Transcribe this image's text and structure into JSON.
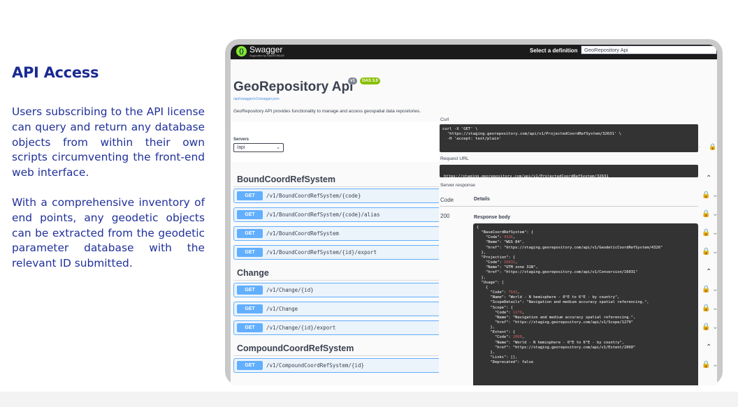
{
  "left": {
    "heading": "API Access",
    "para1": "Users subscribing to the API license can query and return any database objects from within their own scripts circumventing the front-end web interface.",
    "para2": "With a comprehensive inventory of end points, any geodetic objects can be extracted from the geodetic parameter database with the relevant ID submitted."
  },
  "topbar": {
    "logo_text": "Swagger",
    "logo_sub": "Supported by SMARTBEAR",
    "definition_label": "Select a definition",
    "definition_value": "GeoRepository Api"
  },
  "api": {
    "title": "GeoRepository Api",
    "version_badge": "v1",
    "oas_badge": "OAS 3.0",
    "spec_url": "/api/swagger/v1/swagger.json",
    "description": "GeoRepository API provides functionality to manage and access geospatial data repositories.",
    "servers_label": "Servers",
    "servers_value": "/api"
  },
  "sections": [
    {
      "tag": "BoundCoordRefSystem",
      "ops": [
        {
          "method": "GET",
          "path": "/v1/BoundCoordRefSystem/{code}"
        },
        {
          "method": "GET",
          "path": "/v1/BoundCoordRefSystem/{code}/alias"
        },
        {
          "method": "GET",
          "path": "/v1/BoundCoordRefSystem"
        },
        {
          "method": "GET",
          "path": "/v1/BoundCoordRefSystem/{id}/export"
        }
      ]
    },
    {
      "tag": "Change",
      "ops": [
        {
          "method": "GET",
          "path": "/v1/Change/{id}"
        },
        {
          "method": "GET",
          "path": "/v1/Change"
        },
        {
          "method": "GET",
          "path": "/v1/Change/{id}/export"
        }
      ]
    },
    {
      "tag": "CompoundCoordRefSystem",
      "ops": [
        {
          "method": "GET",
          "path": "/v1/CompoundCoordRefSystem/{id}"
        }
      ]
    }
  ],
  "response": {
    "curl_label": "Curl",
    "curl_lines": [
      "curl -X 'GET' \\",
      "  'https://staging.georepository.com/api/v1/ProjectedCoordRefSystem/32631' \\",
      "  -H 'accept: text/plain'"
    ],
    "request_url_label": "Request URL",
    "request_url": "https://staging.georepository.com/api/v1/ProjectedCoordRefSystem/32631",
    "server_response_label": "Server response",
    "code_header": "Code",
    "details_header": "Details",
    "status_code": "200",
    "response_body_label": "Response body",
    "body_lines": [
      "{",
      "  \"BaseCoordRefSystem\": {",
      "    \"Code\": 4326,",
      "    \"Name\": \"WGS 84\",",
      "    \"href\": \"https://staging.georepository.com/api/v1/GeodeticCoordRefSystem/4326\"",
      "  },",
      "  \"Projection\": {",
      "    \"Code\": 16031,",
      "    \"Name\": \"UTM zone 31N\",",
      "    \"href\": \"https://staging.georepository.com/api/v1/Conversion/16031\"",
      "  },",
      "  \"Usage\": [",
      "    {",
      "      \"Code\": 7542,",
      "      \"Name\": \"World - N hemisphere - 0°E to 6°E - by country\",",
      "      \"ScopeDetails\": \"Navigation and medium accuracy spatial referencing.\",",
      "      \"Scope\": {",
      "        \"Code\": 1279,",
      "        \"Name\": \"Navigation and medium accuracy spatial referencing.\",",
      "        \"href\": \"https://staging.georepository.com/api/v1/Scope/1279\"",
      "      },",
      "      \"Extent\": {",
      "        \"Code\": 2060,",
      "        \"Name\": \"World - N hemisphere - 0°E to 6°E - by country\",",
      "        \"href\": \"https://staging.georepository.com/api/v1/Extent/2060\"",
      "      },",
      "      \"Links\": [],",
      "      \"Deprecated\": false"
    ]
  }
}
